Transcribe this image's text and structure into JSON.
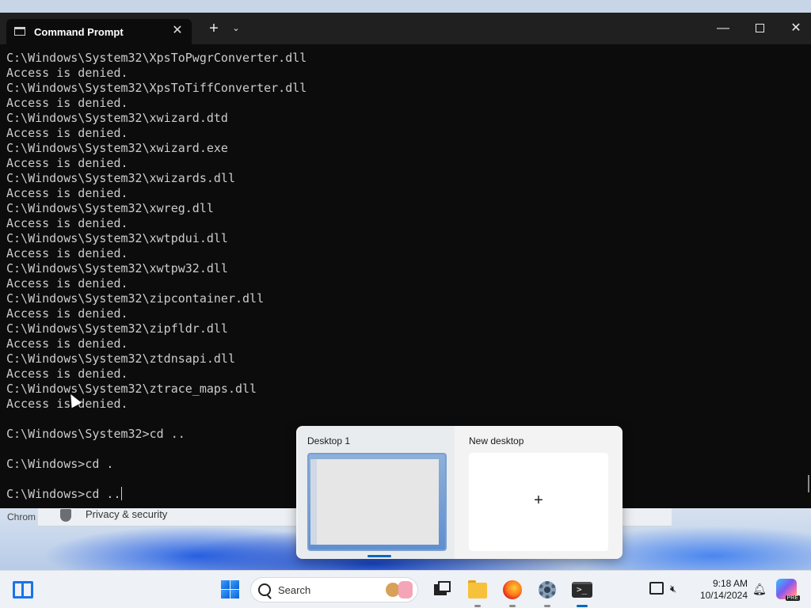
{
  "window": {
    "tab_title": "Command Prompt",
    "close_tab": "✕",
    "new_tab": "+",
    "dropdown": "⌄",
    "minimize": "—",
    "close": "✕"
  },
  "console_lines": [
    "C:\\Windows\\System32\\XpsToPwgrConverter.dll",
    "Access is denied.",
    "C:\\Windows\\System32\\XpsToTiffConverter.dll",
    "Access is denied.",
    "C:\\Windows\\System32\\xwizard.dtd",
    "Access is denied.",
    "C:\\Windows\\System32\\xwizard.exe",
    "Access is denied.",
    "C:\\Windows\\System32\\xwizards.dll",
    "Access is denied.",
    "C:\\Windows\\System32\\xwreg.dll",
    "Access is denied.",
    "C:\\Windows\\System32\\xwtpdui.dll",
    "Access is denied.",
    "C:\\Windows\\System32\\xwtpw32.dll",
    "Access is denied.",
    "C:\\Windows\\System32\\zipcontainer.dll",
    "Access is denied.",
    "C:\\Windows\\System32\\zipfldr.dll",
    "Access is denied.",
    "C:\\Windows\\System32\\ztdnsapi.dll",
    "Access is denied.",
    "C:\\Windows\\System32\\ztrace_maps.dll",
    "Access is denied.",
    "",
    "C:\\Windows\\System32>cd ..",
    "",
    "C:\\Windows>cd .",
    "",
    "C:\\Windows>cd .."
  ],
  "background": {
    "chrome_label": "Chrom",
    "settings_item": "Privacy & security"
  },
  "taskview": {
    "desktop1_label": "Desktop 1",
    "new_desktop_label": "New desktop",
    "plus": "+"
  },
  "taskbar": {
    "search_placeholder": "Search",
    "time": "9:18 AM",
    "date": "10/14/2024",
    "copilot_badge": "PRE"
  }
}
